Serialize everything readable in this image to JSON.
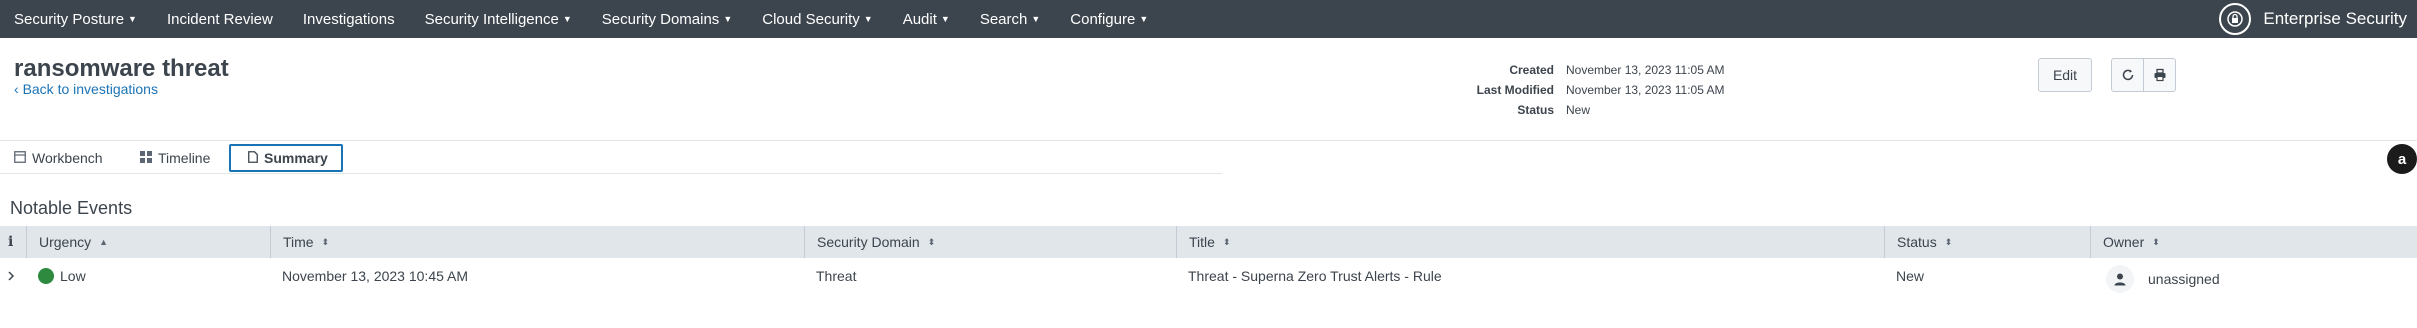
{
  "nav": {
    "items": [
      {
        "label": "Security Posture",
        "has_caret": true
      },
      {
        "label": "Incident Review",
        "has_caret": false
      },
      {
        "label": "Investigations",
        "has_caret": false
      },
      {
        "label": "Security Intelligence",
        "has_caret": true
      },
      {
        "label": "Security Domains",
        "has_caret": true
      },
      {
        "label": "Cloud Security",
        "has_caret": true
      },
      {
        "label": "Audit",
        "has_caret": true
      },
      {
        "label": "Search",
        "has_caret": true
      },
      {
        "label": "Configure",
        "has_caret": true
      }
    ],
    "brand": "Enterprise Security"
  },
  "header": {
    "title": "ransomware threat",
    "back_link": "Back to investigations",
    "meta": [
      {
        "label": "Created",
        "value": "November 13, 2023 11:05 AM"
      },
      {
        "label": "Last Modified",
        "value": "November 13, 2023 11:05 AM"
      },
      {
        "label": "Status",
        "value": "New"
      }
    ],
    "edit_label": "Edit"
  },
  "tabs": [
    {
      "label": "Workbench",
      "icon": "workbench-icon",
      "active": false
    },
    {
      "label": "Timeline",
      "icon": "timeline-icon",
      "active": false
    },
    {
      "label": "Summary",
      "icon": "document-icon",
      "active": true
    }
  ],
  "user_avatar": "a",
  "notable": {
    "title": "Notable Events",
    "columns": [
      "Urgency",
      "Time",
      "Security Domain",
      "Title",
      "Status",
      "Owner"
    ],
    "sorted_column": "Urgency",
    "rows": [
      {
        "urgency": "Low",
        "urgency_color": "#2d8a3e",
        "time": "November 13, 2023 10:45 AM",
        "security_domain": "Threat",
        "title": "Threat - Superna Zero Trust Alerts - Rule",
        "status": "New",
        "owner": "unassigned"
      }
    ]
  },
  "colors": {
    "nav_bg": "#3c444d",
    "accent": "#1a73b5",
    "header_bg": "#e1e6eb"
  }
}
